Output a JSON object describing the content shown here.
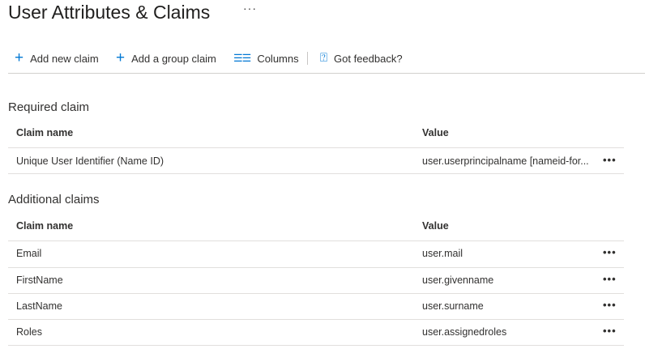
{
  "header": {
    "title": "User Attributes & Claims",
    "more": "···"
  },
  "toolbar": {
    "add_new_claim": "Add new claim",
    "add_group_claim": "Add a group claim",
    "columns": "Columns",
    "feedback": "Got feedback?"
  },
  "required": {
    "title": "Required claim",
    "col_name": "Claim name",
    "col_value": "Value",
    "rows": [
      {
        "name": "Unique User Identifier (Name ID)",
        "value": "user.userprincipalname [nameid-for..."
      }
    ]
  },
  "additional": {
    "title": "Additional claims",
    "col_name": "Claim name",
    "col_value": "Value",
    "rows": [
      {
        "name": "Email",
        "value": "user.mail"
      },
      {
        "name": "FirstName",
        "value": "user.givenname"
      },
      {
        "name": "LastName",
        "value": "user.surname"
      },
      {
        "name": "Roles",
        "value": "user.assignedroles"
      }
    ]
  },
  "row_menu": "•••"
}
